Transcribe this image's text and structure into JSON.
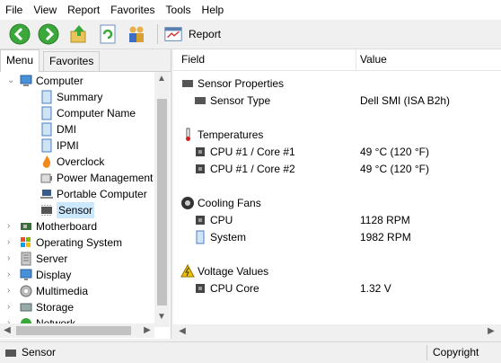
{
  "menu": [
    "File",
    "View",
    "Report",
    "Favorites",
    "Tools",
    "Help"
  ],
  "toolbar": {
    "report_label": "Report",
    "icons": [
      "back-icon",
      "forward-icon",
      "up-icon",
      "refresh-icon",
      "users-icon",
      "report-icon"
    ]
  },
  "left_tabs": [
    "Menu",
    "Favorites"
  ],
  "tree": {
    "root": "Computer",
    "children": [
      "Summary",
      "Computer Name",
      "DMI",
      "IPMI",
      "Overclock",
      "Power Management",
      "Portable Computer",
      "Sensor"
    ],
    "selected": "Sensor",
    "siblings": [
      "Motherboard",
      "Operating System",
      "Server",
      "Display",
      "Multimedia",
      "Storage",
      "Network"
    ]
  },
  "table": {
    "columns": [
      "Field",
      "Value"
    ],
    "groups": [
      {
        "title": "Sensor Properties",
        "rows": [
          {
            "field": "Sensor Type",
            "value": "Dell SMI  (ISA B2h)"
          }
        ]
      },
      {
        "title": "Temperatures",
        "rows": [
          {
            "field": "CPU #1 / Core #1",
            "value": "49 °C  (120 °F)"
          },
          {
            "field": "CPU #1 / Core #2",
            "value": "49 °C  (120 °F)"
          }
        ]
      },
      {
        "title": "Cooling Fans",
        "rows": [
          {
            "field": "CPU",
            "value": "1128 RPM"
          },
          {
            "field": "System",
            "value": "1982 RPM"
          }
        ]
      },
      {
        "title": "Voltage Values",
        "rows": [
          {
            "field": "CPU Core",
            "value": "1.32 V"
          }
        ]
      }
    ]
  },
  "status": {
    "left": "Sensor",
    "right": "Copyright"
  },
  "colors": {
    "selection": "#cce8ff",
    "nav_green": "#3aa83a"
  }
}
